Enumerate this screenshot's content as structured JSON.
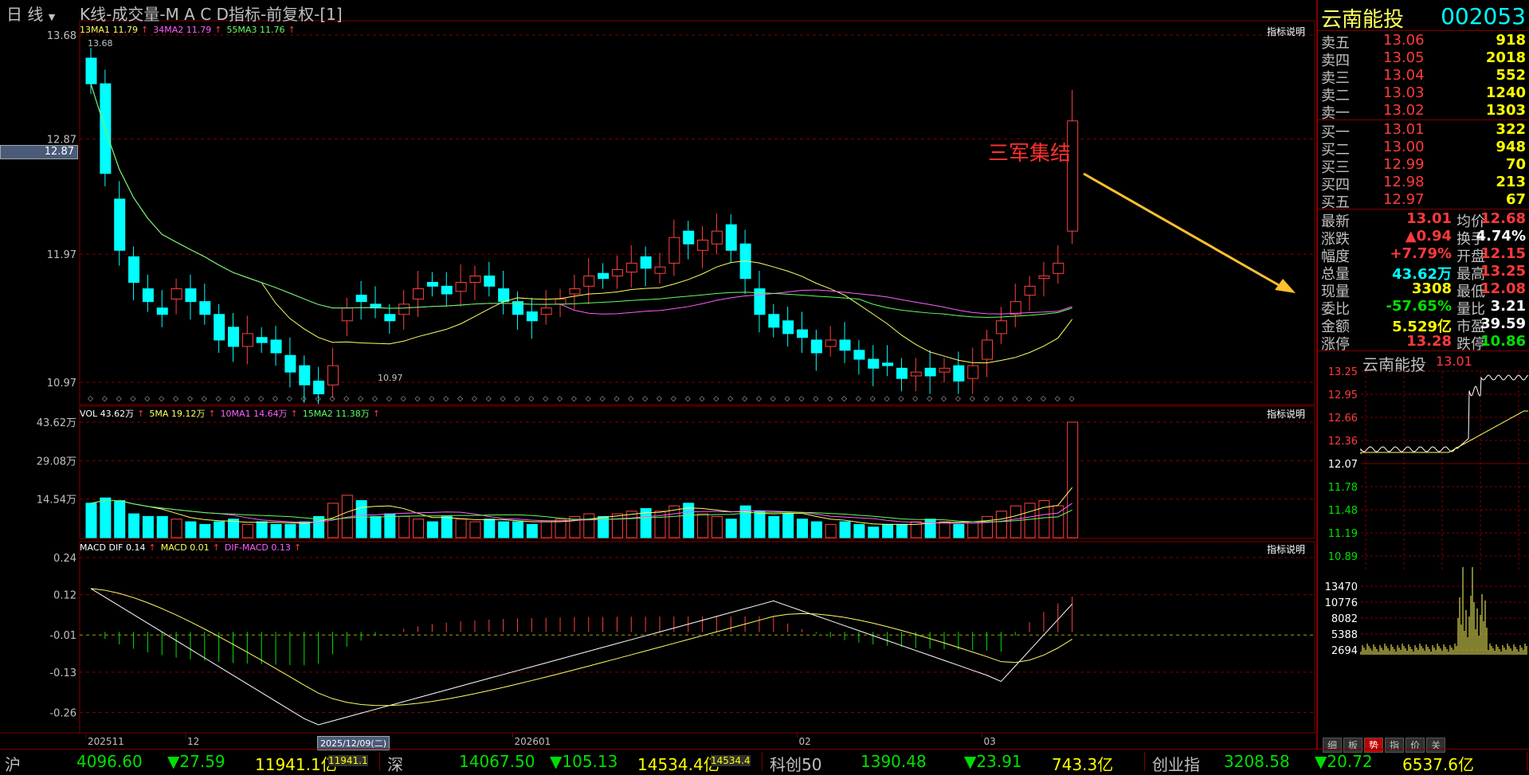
{
  "header": {
    "period_label": "日  线",
    "title": "K线-成交量-M A C D指标-前复权-[1]",
    "indicator_note": "指标说明"
  },
  "stock": {
    "name": "云南能投",
    "code": "002053"
  },
  "kline": {
    "ma_legend": [
      {
        "text": "13MA1 11.79",
        "color": "#ffff60"
      },
      {
        "text": "34MA2 11.79",
        "color": "#ff60ff"
      },
      {
        "text": "55MA3 11.76",
        "color": "#60ff60"
      }
    ],
    "y_ticks": [
      "13.68",
      "12.87",
      "11.97",
      "10.97"
    ],
    "cursor_price": "12.87",
    "high_label": "13.68",
    "low_label": "10.97",
    "annotation": "三军集结"
  },
  "volume": {
    "legend": [
      {
        "text": "VOL 43.62万",
        "color": "#ffffff"
      },
      {
        "text": "5MA 19.12万",
        "color": "#ffff60"
      },
      {
        "text": "10MA1 14.64万",
        "color": "#ff60ff"
      },
      {
        "text": "15MA2 11.38万",
        "color": "#60ff60"
      }
    ],
    "y_ticks": [
      "43.62万",
      "29.08万",
      "14.54万"
    ]
  },
  "macd": {
    "legend": [
      {
        "text": "MACD DIF 0.14",
        "color": "#ffffff"
      },
      {
        "text": "MACD 0.01",
        "color": "#ffff60"
      },
      {
        "text": "DIF-MACD 0.13",
        "color": "#ff60ff"
      }
    ],
    "y_ticks": [
      "0.24",
      "0.12",
      "-0.01",
      "-0.13",
      "-0.26"
    ]
  },
  "x_axis": {
    "labels": [
      "202511",
      "12",
      "202601",
      "02",
      "03"
    ],
    "cursor_date": "2025/12/09(二)"
  },
  "orderbook": {
    "sell": [
      {
        "label": "卖五",
        "price": "13.06",
        "vol": "918"
      },
      {
        "label": "卖四",
        "price": "13.05",
        "vol": "2018"
      },
      {
        "label": "卖三",
        "price": "13.04",
        "vol": "552"
      },
      {
        "label": "卖二",
        "price": "13.03",
        "vol": "1240"
      },
      {
        "label": "卖一",
        "price": "13.02",
        "vol": "1303"
      }
    ],
    "buy": [
      {
        "label": "买一",
        "price": "13.01",
        "vol": "322"
      },
      {
        "label": "买二",
        "price": "13.00",
        "vol": "948"
      },
      {
        "label": "买三",
        "price": "12.99",
        "vol": "70"
      },
      {
        "label": "买四",
        "price": "12.98",
        "vol": "213"
      },
      {
        "label": "买五",
        "price": "12.97",
        "vol": "67"
      }
    ]
  },
  "stats": [
    {
      "l1": "最新",
      "v1": "13.01",
      "c1": "#ff3a3a",
      "l2": "均价",
      "v2": "12.68",
      "c2": "#ff3a3a"
    },
    {
      "l1": "涨跌",
      "v1": "▲0.94",
      "c1": "#ff3a3a",
      "l2": "换手",
      "v2": "4.74%",
      "c2": "#ffffff"
    },
    {
      "l1": "幅度",
      "v1": "+7.79%",
      "c1": "#ff3a3a",
      "l2": "开盘",
      "v2": "12.15",
      "c2": "#ff3a3a"
    },
    {
      "l1": "总量",
      "v1": "43.62万",
      "c1": "#00ffff",
      "l2": "最高",
      "v2": "13.25",
      "c2": "#ff3a3a"
    },
    {
      "l1": "现量",
      "v1": "3308",
      "c1": "#ffff00",
      "l2": "最低",
      "v2": "12.08",
      "c2": "#ff3a3a"
    },
    {
      "l1": "委比",
      "v1": "-57.65%",
      "c1": "#00e000",
      "l2": "量比",
      "v2": "3.21",
      "c2": "#ffffff"
    },
    {
      "l1": "金额",
      "v1": "5.529亿",
      "c1": "#ffff00",
      "l2": "市盈",
      "v2": "39.59",
      "c2": "#ffffff"
    },
    {
      "l1": "涨停",
      "v1": "13.28",
      "c1": "#ff3a3a",
      "l2": "跌停",
      "v2": "10.86",
      "c2": "#00e000"
    }
  ],
  "mini_chart": {
    "title_name": "云南能投",
    "title_price": "13.01",
    "price_ticks": [
      "13.25",
      "12.95",
      "12.66",
      "12.36",
      "12.07",
      "11.78",
      "11.48",
      "11.19",
      "10.89"
    ],
    "vol_ticks": [
      "13470",
      "10776",
      "8082",
      "5388",
      "2694"
    ]
  },
  "mini_tabs": [
    "细",
    "板",
    "势",
    "指",
    "价",
    "关"
  ],
  "index_bar": [
    {
      "name": "沪",
      "value": "4096.60",
      "change": "▼27.59",
      "amount": "11941.1亿",
      "tag": "11941.1"
    },
    {
      "name": "深",
      "value": "14067.50",
      "change": "▼105.13",
      "amount": "14534.4亿",
      "tag": "14534.4"
    },
    {
      "name": "科创50",
      "value": "1390.48",
      "change": "▼23.91",
      "amount": "743.3亿",
      "tag": ""
    },
    {
      "name": "创业指",
      "value": "3208.58",
      "change": "▼20.72",
      "amount": "6537.6亿",
      "tag": ""
    }
  ]
}
